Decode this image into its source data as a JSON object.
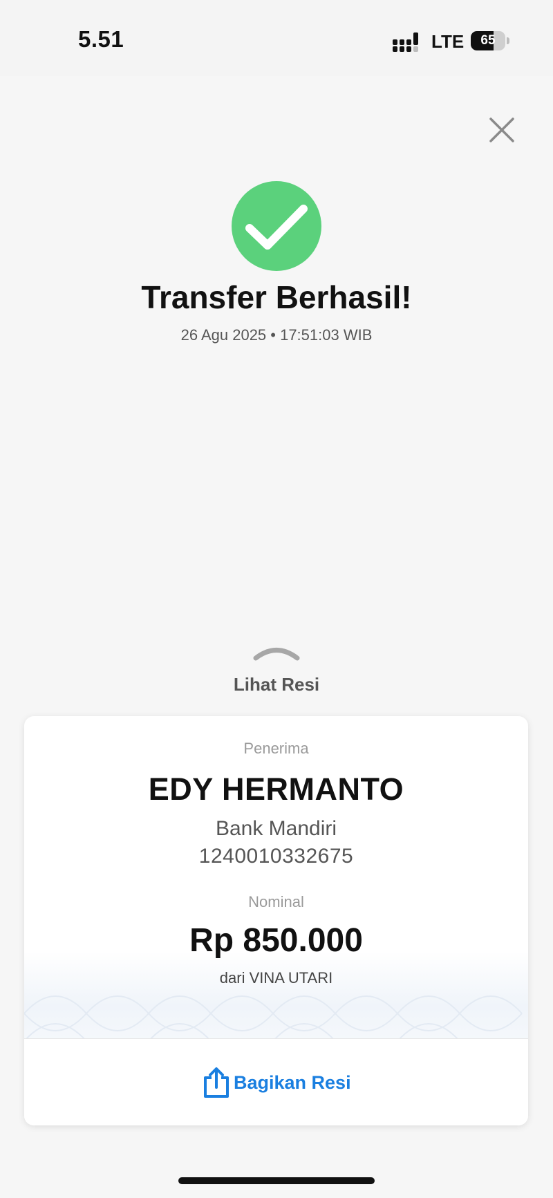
{
  "status_bar": {
    "time": "5.51",
    "network": "LTE",
    "battery_level": "65",
    "battery_fraction": 0.65,
    "icons": [
      "signal-icon",
      "battery-icon"
    ]
  },
  "header": {
    "close_icon": "close-icon",
    "success_icon": "checkmark-circle-icon",
    "title": "Transfer Berhasil!",
    "datetime": "26 Agu 2025 • 17:51:03 WIB"
  },
  "receipt_toggle": {
    "icon": "chevron-up-icon",
    "label": "Lihat Resi"
  },
  "receipt": {
    "recipient_label": "Penerima",
    "recipient_name": "EDY HERMANTO",
    "bank": "Bank Mandiri",
    "account_number": "1240010332675",
    "amount_label": "Nominal",
    "amount": "Rp 850.000",
    "sender": "dari VINA UTARI",
    "share_icon": "share-icon",
    "share_label": "Bagikan Resi"
  },
  "colors": {
    "success_green": "#5bd17c",
    "link_blue": "#1a7fe0",
    "background": "#f6f6f6"
  }
}
